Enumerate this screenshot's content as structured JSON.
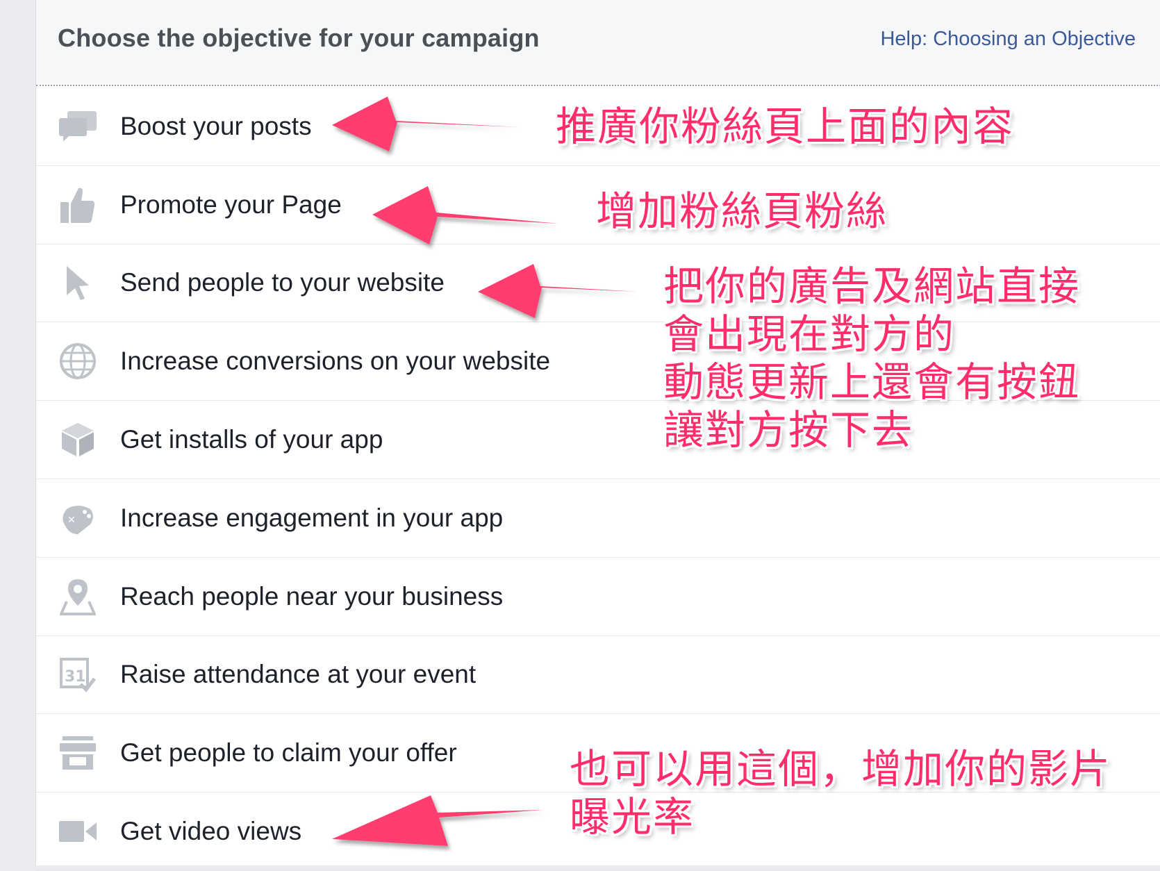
{
  "header": {
    "title": "Choose the objective for your campaign",
    "help_link": "Help: Choosing an Objective"
  },
  "objectives": [
    {
      "label": "Boost your posts",
      "icon": "speech-bubbles-icon"
    },
    {
      "label": "Promote your Page",
      "icon": "thumbs-up-icon"
    },
    {
      "label": "Send people to your website",
      "icon": "cursor-icon"
    },
    {
      "label": "Increase conversions on your website",
      "icon": "globe-icon"
    },
    {
      "label": "Get installs of your app",
      "icon": "cube-icon"
    },
    {
      "label": "Increase engagement in your app",
      "icon": "gamepad-icon"
    },
    {
      "label": "Reach people near your business",
      "icon": "map-pin-icon"
    },
    {
      "label": "Raise attendance at your event",
      "icon": "calendar-icon"
    },
    {
      "label": "Get people to claim your offer",
      "icon": "storefront-icon"
    },
    {
      "label": "Get video views",
      "icon": "video-camera-icon"
    }
  ],
  "annotations": {
    "boost": [
      "推廣你粉絲頁上面的內容"
    ],
    "promote": [
      "增加粉絲頁粉絲"
    ],
    "website": [
      "把你的廣告及網站直接",
      "會出現在對方的",
      "動態更新上還會有按鈕",
      "讓對方按下去"
    ],
    "video": [
      "也可以用這個，增加你的影片",
      "曝光率"
    ]
  },
  "colors": {
    "annotation": "#ff2d6a",
    "icon": "#bec3c9",
    "link": "#3b5998",
    "header_bg": "#f6f7f9"
  }
}
